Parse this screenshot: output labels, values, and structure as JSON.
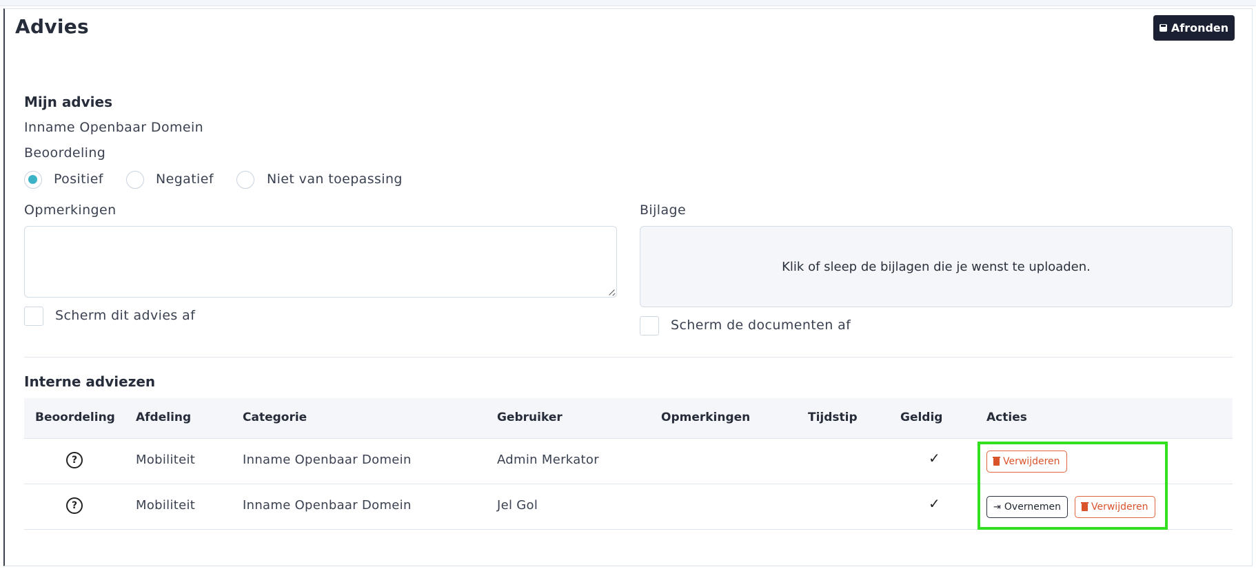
{
  "header": {
    "title": "Advies",
    "finish_label": "Afronden"
  },
  "my_advice": {
    "heading": "Mijn advies",
    "category": "Inname Openbaar Domein",
    "rating_label": "Beoordeling",
    "options": [
      {
        "label": "Positief",
        "selected": true
      },
      {
        "label": "Negatief",
        "selected": false
      },
      {
        "label": "Niet van toepassing",
        "selected": false
      }
    ],
    "remarks_label": "Opmerkingen",
    "remarks_value": "",
    "shield_advice_label": "Scherm dit advies af",
    "attachment_label": "Bijlage",
    "dropzone_text": "Klik of sleep de bijlagen die je wenst te uploaden.",
    "shield_docs_label": "Scherm de documenten af"
  },
  "internal": {
    "heading": "Interne adviezen",
    "columns": [
      "Beoordeling",
      "Afdeling",
      "Categorie",
      "Gebruiker",
      "Opmerkingen",
      "Tijdstip",
      "Geldig",
      "Acties"
    ],
    "rows": [
      {
        "rating_icon": "question-icon",
        "department": "Mobiliteit",
        "category": "Inname Openbaar Domein",
        "user": "Admin Merkator",
        "remarks": "",
        "time": "",
        "valid": true
      },
      {
        "rating_icon": "question-icon",
        "department": "Mobiliteit",
        "category": "Inname Openbaar Domein",
        "user": "Jel Gol",
        "remarks": "",
        "time": "",
        "valid": true
      }
    ],
    "actions": {
      "delete_label": "Verwijderen",
      "take_over_label": "Overnemen"
    }
  },
  "colors": {
    "accent": "#3bb2c6",
    "primary_dark": "#1b2033",
    "danger": "#d9532b",
    "highlight": "#33e01f"
  }
}
